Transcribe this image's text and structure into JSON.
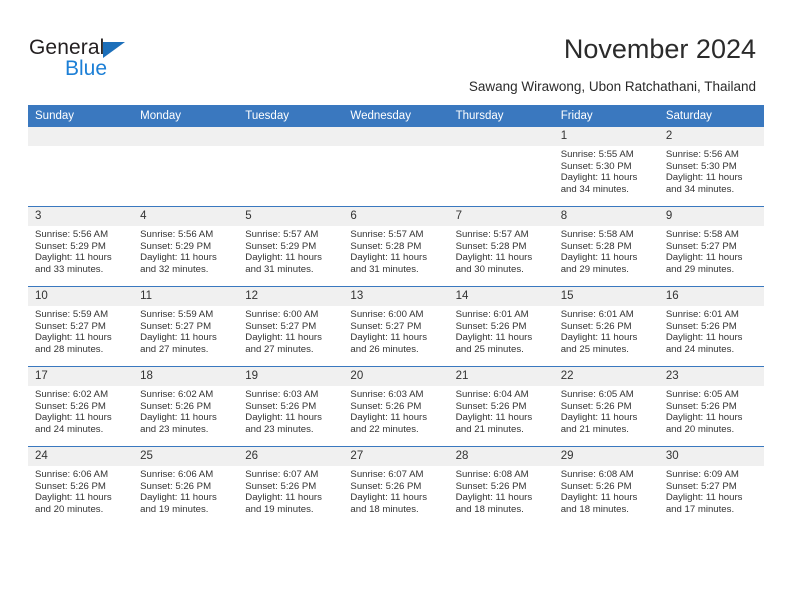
{
  "brand": {
    "name_top": "General",
    "name_bottom": "Blue",
    "accent_blue": "#1c7fd6",
    "header_blue": "#3a78bf"
  },
  "header": {
    "title": "November 2024",
    "subtitle": "Sawang Wirawong, Ubon Ratchathani, Thailand"
  },
  "calendar": {
    "weekday_headers": [
      "Sunday",
      "Monday",
      "Tuesday",
      "Wednesday",
      "Thursday",
      "Friday",
      "Saturday"
    ],
    "weeks": [
      [
        {
          "day": "",
          "sunrise": "",
          "sunset": "",
          "daylight1": "",
          "daylight2": ""
        },
        {
          "day": "",
          "sunrise": "",
          "sunset": "",
          "daylight1": "",
          "daylight2": ""
        },
        {
          "day": "",
          "sunrise": "",
          "sunset": "",
          "daylight1": "",
          "daylight2": ""
        },
        {
          "day": "",
          "sunrise": "",
          "sunset": "",
          "daylight1": "",
          "daylight2": ""
        },
        {
          "day": "",
          "sunrise": "",
          "sunset": "",
          "daylight1": "",
          "daylight2": ""
        },
        {
          "day": "1",
          "sunrise": "Sunrise: 5:55 AM",
          "sunset": "Sunset: 5:30 PM",
          "daylight1": "Daylight: 11 hours",
          "daylight2": "and 34 minutes."
        },
        {
          "day": "2",
          "sunrise": "Sunrise: 5:56 AM",
          "sunset": "Sunset: 5:30 PM",
          "daylight1": "Daylight: 11 hours",
          "daylight2": "and 34 minutes."
        }
      ],
      [
        {
          "day": "3",
          "sunrise": "Sunrise: 5:56 AM",
          "sunset": "Sunset: 5:29 PM",
          "daylight1": "Daylight: 11 hours",
          "daylight2": "and 33 minutes."
        },
        {
          "day": "4",
          "sunrise": "Sunrise: 5:56 AM",
          "sunset": "Sunset: 5:29 PM",
          "daylight1": "Daylight: 11 hours",
          "daylight2": "and 32 minutes."
        },
        {
          "day": "5",
          "sunrise": "Sunrise: 5:57 AM",
          "sunset": "Sunset: 5:29 PM",
          "daylight1": "Daylight: 11 hours",
          "daylight2": "and 31 minutes."
        },
        {
          "day": "6",
          "sunrise": "Sunrise: 5:57 AM",
          "sunset": "Sunset: 5:28 PM",
          "daylight1": "Daylight: 11 hours",
          "daylight2": "and 31 minutes."
        },
        {
          "day": "7",
          "sunrise": "Sunrise: 5:57 AM",
          "sunset": "Sunset: 5:28 PM",
          "daylight1": "Daylight: 11 hours",
          "daylight2": "and 30 minutes."
        },
        {
          "day": "8",
          "sunrise": "Sunrise: 5:58 AM",
          "sunset": "Sunset: 5:28 PM",
          "daylight1": "Daylight: 11 hours",
          "daylight2": "and 29 minutes."
        },
        {
          "day": "9",
          "sunrise": "Sunrise: 5:58 AM",
          "sunset": "Sunset: 5:27 PM",
          "daylight1": "Daylight: 11 hours",
          "daylight2": "and 29 minutes."
        }
      ],
      [
        {
          "day": "10",
          "sunrise": "Sunrise: 5:59 AM",
          "sunset": "Sunset: 5:27 PM",
          "daylight1": "Daylight: 11 hours",
          "daylight2": "and 28 minutes."
        },
        {
          "day": "11",
          "sunrise": "Sunrise: 5:59 AM",
          "sunset": "Sunset: 5:27 PM",
          "daylight1": "Daylight: 11 hours",
          "daylight2": "and 27 minutes."
        },
        {
          "day": "12",
          "sunrise": "Sunrise: 6:00 AM",
          "sunset": "Sunset: 5:27 PM",
          "daylight1": "Daylight: 11 hours",
          "daylight2": "and 27 minutes."
        },
        {
          "day": "13",
          "sunrise": "Sunrise: 6:00 AM",
          "sunset": "Sunset: 5:27 PM",
          "daylight1": "Daylight: 11 hours",
          "daylight2": "and 26 minutes."
        },
        {
          "day": "14",
          "sunrise": "Sunrise: 6:01 AM",
          "sunset": "Sunset: 5:26 PM",
          "daylight1": "Daylight: 11 hours",
          "daylight2": "and 25 minutes."
        },
        {
          "day": "15",
          "sunrise": "Sunrise: 6:01 AM",
          "sunset": "Sunset: 5:26 PM",
          "daylight1": "Daylight: 11 hours",
          "daylight2": "and 25 minutes."
        },
        {
          "day": "16",
          "sunrise": "Sunrise: 6:01 AM",
          "sunset": "Sunset: 5:26 PM",
          "daylight1": "Daylight: 11 hours",
          "daylight2": "and 24 minutes."
        }
      ],
      [
        {
          "day": "17",
          "sunrise": "Sunrise: 6:02 AM",
          "sunset": "Sunset: 5:26 PM",
          "daylight1": "Daylight: 11 hours",
          "daylight2": "and 24 minutes."
        },
        {
          "day": "18",
          "sunrise": "Sunrise: 6:02 AM",
          "sunset": "Sunset: 5:26 PM",
          "daylight1": "Daylight: 11 hours",
          "daylight2": "and 23 minutes."
        },
        {
          "day": "19",
          "sunrise": "Sunrise: 6:03 AM",
          "sunset": "Sunset: 5:26 PM",
          "daylight1": "Daylight: 11 hours",
          "daylight2": "and 23 minutes."
        },
        {
          "day": "20",
          "sunrise": "Sunrise: 6:03 AM",
          "sunset": "Sunset: 5:26 PM",
          "daylight1": "Daylight: 11 hours",
          "daylight2": "and 22 minutes."
        },
        {
          "day": "21",
          "sunrise": "Sunrise: 6:04 AM",
          "sunset": "Sunset: 5:26 PM",
          "daylight1": "Daylight: 11 hours",
          "daylight2": "and 21 minutes."
        },
        {
          "day": "22",
          "sunrise": "Sunrise: 6:05 AM",
          "sunset": "Sunset: 5:26 PM",
          "daylight1": "Daylight: 11 hours",
          "daylight2": "and 21 minutes."
        },
        {
          "day": "23",
          "sunrise": "Sunrise: 6:05 AM",
          "sunset": "Sunset: 5:26 PM",
          "daylight1": "Daylight: 11 hours",
          "daylight2": "and 20 minutes."
        }
      ],
      [
        {
          "day": "24",
          "sunrise": "Sunrise: 6:06 AM",
          "sunset": "Sunset: 5:26 PM",
          "daylight1": "Daylight: 11 hours",
          "daylight2": "and 20 minutes."
        },
        {
          "day": "25",
          "sunrise": "Sunrise: 6:06 AM",
          "sunset": "Sunset: 5:26 PM",
          "daylight1": "Daylight: 11 hours",
          "daylight2": "and 19 minutes."
        },
        {
          "day": "26",
          "sunrise": "Sunrise: 6:07 AM",
          "sunset": "Sunset: 5:26 PM",
          "daylight1": "Daylight: 11 hours",
          "daylight2": "and 19 minutes."
        },
        {
          "day": "27",
          "sunrise": "Sunrise: 6:07 AM",
          "sunset": "Sunset: 5:26 PM",
          "daylight1": "Daylight: 11 hours",
          "daylight2": "and 18 minutes."
        },
        {
          "day": "28",
          "sunrise": "Sunrise: 6:08 AM",
          "sunset": "Sunset: 5:26 PM",
          "daylight1": "Daylight: 11 hours",
          "daylight2": "and 18 minutes."
        },
        {
          "day": "29",
          "sunrise": "Sunrise: 6:08 AM",
          "sunset": "Sunset: 5:26 PM",
          "daylight1": "Daylight: 11 hours",
          "daylight2": "and 18 minutes."
        },
        {
          "day": "30",
          "sunrise": "Sunrise: 6:09 AM",
          "sunset": "Sunset: 5:27 PM",
          "daylight1": "Daylight: 11 hours",
          "daylight2": "and 17 minutes."
        }
      ]
    ]
  }
}
